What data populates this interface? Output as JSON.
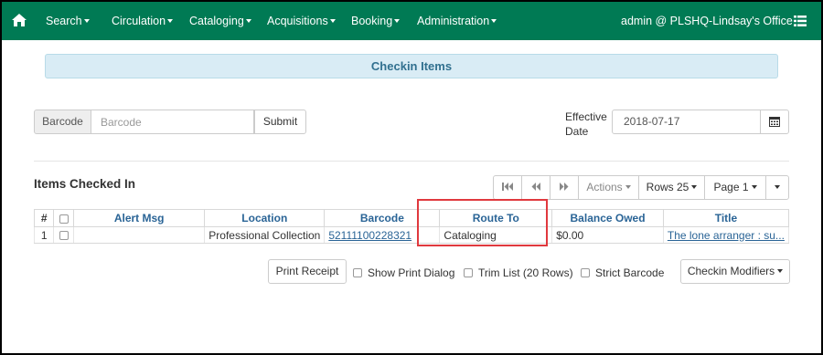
{
  "nav": {
    "items": [
      {
        "label": "Search"
      },
      {
        "label": "Circulation"
      },
      {
        "label": "Cataloging"
      },
      {
        "label": "Acquisitions"
      },
      {
        "label": "Booking"
      },
      {
        "label": "Administration"
      }
    ],
    "user": "admin @ PLSHQ-Lindsay's Office",
    "home_icon": "home-icon",
    "menu_icon": "list-icon"
  },
  "banner": {
    "title": "Checkin Items"
  },
  "barcode": {
    "addon_label": "Barcode",
    "placeholder": "Barcode",
    "value": "",
    "submit_label": "Submit"
  },
  "effective_date": {
    "label": "Effective Date",
    "value": "2018-07-17",
    "calendar_icon": "calendar-icon"
  },
  "items_section": {
    "title": "Items Checked In",
    "toolbar": {
      "actions_label": "Actions",
      "rows_label": "Rows 25",
      "page_label": "Page 1"
    },
    "columns": [
      "#",
      "",
      "Alert Msg",
      "Location",
      "Barcode",
      "Route To",
      "Balance Owed",
      "Title"
    ],
    "rows": [
      {
        "index": "1",
        "alert_msg": "",
        "location": "Professional Collection",
        "barcode": "52111100228321",
        "route_to": "Cataloging",
        "balance_owed": "$0.00",
        "title": "The lone arranger : su..."
      }
    ]
  },
  "footer": {
    "print_receipt_label": "Print Receipt",
    "show_print_dialog_label": "Show Print Dialog",
    "trim_list_label": "Trim List (20 Rows)",
    "strict_barcode_label": "Strict Barcode",
    "checkin_modifiers_label": "Checkin Modifiers"
  },
  "colors": {
    "navbar": "#007a54",
    "banner_bg": "#d9ecf5",
    "banner_text": "#31708f",
    "link": "#2a6496",
    "highlight": "#e0393e"
  }
}
